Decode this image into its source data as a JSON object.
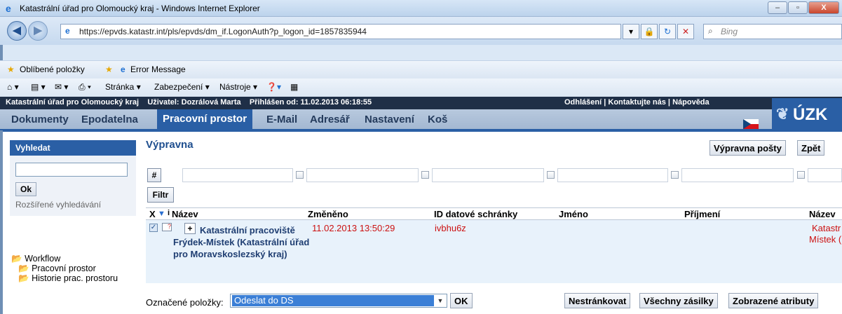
{
  "window": {
    "title": "Katastrální úřad pro Olomoucký kraj - Windows Internet Explorer",
    "min_label": "–",
    "max_label": "▫",
    "close_label": "X"
  },
  "browser": {
    "back": "◀",
    "forward": "▶",
    "url": "https://epvds.katastr.int/pls/epvds/dm_if.LogonAuth?p_logon_id=1857835944",
    "search_placeholder": "Bing",
    "favorites": "Oblíbené položky",
    "error_tab": "Error Message",
    "toolbar": {
      "page": "Stránka ▾",
      "security": "Zabezpečení ▾",
      "tools": "Nástroje ▾"
    }
  },
  "app_header": {
    "left": "Katastrální úřad pro Olomoucký kraj    Uživatel: Dozrálová Marta    Přihlášen od: 11.02.2013 06:18:55",
    "right": "Odhlášení | Kontaktujte nás | Nápověda"
  },
  "menu": {
    "items": [
      "Dokumenty",
      "Epodatelna",
      "Pracovní prostor",
      "E-Mail",
      "Adresář",
      "Nastavení",
      "Koš"
    ],
    "active": "Pracovní prostor"
  },
  "logo": "ÚZK",
  "sidebar": {
    "search_title": "Vyhledat",
    "ok": "Ok",
    "advanced": "Rozšířené vyhledávání",
    "tree": {
      "root": "Workflow",
      "items": [
        "Pracovní prostor",
        "Historie prac. prostoru"
      ]
    }
  },
  "main": {
    "title": "Výpravna",
    "btn_posta": "Výpravna pošty",
    "btn_back": "Zpět",
    "hash": "#",
    "filter": "Filtr",
    "columns": {
      "x": "X",
      "i": "i",
      "nazev": "Název",
      "zmeneno": "Změněno",
      "id_ds": "ID datové schránky",
      "jmeno": "Jméno",
      "prijmeni": "Příjmení",
      "nazev2": "Název"
    },
    "row": {
      "nazev": "Katastrální pracoviště Frýdek-Místek (Katastrální úřad pro Moravskoslezský kraj)",
      "zmeneno": "11.02.2013 13:50:29",
      "id_ds": "ivbhu6z",
      "nazev2": "Katastr",
      "nazev2b": "Místek ("
    },
    "marked_label": "Označené položky:",
    "marked_value": "Odeslat do DS",
    "ok": "OK",
    "btn_nestrankovat": "Nestránkovat",
    "btn_vsechny": "Všechny zásilky",
    "btn_atributy": "Zobrazené atributy"
  }
}
